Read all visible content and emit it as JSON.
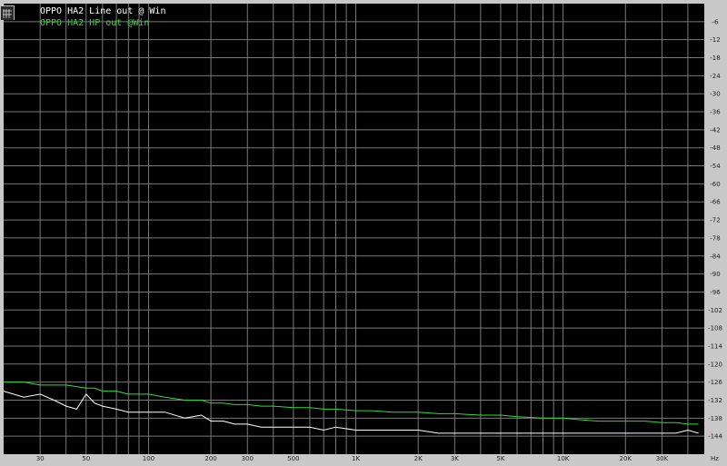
{
  "chart_data": {
    "type": "line",
    "title": "",
    "xlabel": "",
    "ylabel": "",
    "x_unit": "Hz",
    "x_scale": "log",
    "xlim": [
      20,
      48000
    ],
    "ylim": [
      -150,
      0
    ],
    "x_ticks": [
      30,
      50,
      100,
      200,
      300,
      500,
      1000,
      2000,
      3000,
      5000,
      10000,
      20000,
      30000
    ],
    "x_tick_labels": [
      "30",
      "50",
      "100",
      "200",
      "300",
      "500",
      "1K",
      "2K",
      "3K",
      "5K",
      "10K",
      "20K",
      "30K"
    ],
    "y_ticks": [
      -6,
      -12,
      -18,
      -24,
      -30,
      -36,
      -42,
      -48,
      -54,
      -60,
      -66,
      -72,
      -78,
      -84,
      -90,
      -96,
      -102,
      -108,
      -114,
      -120,
      -126,
      -132,
      -138,
      -144
    ],
    "y_tick_labels": [
      "-6",
      "-12",
      "-18",
      "-24",
      "-30",
      "-36",
      "-42",
      "-48",
      "-54",
      "-60",
      "-66",
      "-72",
      "-78",
      "-84",
      "-90",
      "-96",
      "-102",
      "-108",
      "-114",
      "-120",
      "-126",
      "-132",
      "-138",
      "-144"
    ],
    "grid": true,
    "legend_position": "top-left",
    "background_color": "#000000",
    "grid_color": "#7a7a7a",
    "series": [
      {
        "name": "OPPO HA2 Line out @ Win",
        "color": "#ffffff",
        "x": [
          20,
          25,
          30,
          35,
          40,
          45,
          50,
          55,
          60,
          70,
          80,
          100,
          120,
          150,
          180,
          200,
          230,
          260,
          300,
          350,
          400,
          500,
          600,
          700,
          800,
          1000,
          1200,
          1500,
          2000,
          2500,
          3000,
          4000,
          5000,
          6000,
          8000,
          10000,
          12000,
          15000,
          20000,
          25000,
          30000,
          35000,
          40000,
          45000
        ],
        "y": [
          -129,
          -131,
          -130,
          -132,
          -134,
          -135,
          -130,
          -133,
          -134,
          -135,
          -136,
          -136,
          -136,
          -138,
          -137,
          -139,
          -139,
          -140,
          -140,
          -141,
          -141,
          -141,
          -141,
          -142,
          -141,
          -142,
          -142,
          -142,
          -142,
          -143,
          -143,
          -143,
          -143,
          -143,
          -143,
          -143,
          -143,
          -143,
          -143,
          -143,
          -143,
          -143,
          -142,
          -143
        ]
      },
      {
        "name": "OPPO HA2 HP out @Win",
        "color": "#32dc32",
        "x": [
          20,
          25,
          30,
          35,
          40,
          45,
          50,
          55,
          60,
          70,
          80,
          100,
          120,
          150,
          180,
          200,
          230,
          260,
          300,
          350,
          400,
          500,
          600,
          700,
          800,
          1000,
          1200,
          1500,
          2000,
          2500,
          3000,
          4000,
          5000,
          6000,
          8000,
          10000,
          12000,
          15000,
          20000,
          25000,
          30000,
          35000,
          40000,
          45000
        ],
        "y": [
          -126,
          -126,
          -127,
          -127,
          -127,
          -127.5,
          -128,
          -128,
          -129,
          -129,
          -130,
          -130,
          -131,
          -132,
          -132,
          -133,
          -133,
          -133.5,
          -133.5,
          -134,
          -134,
          -134.5,
          -134.5,
          -135,
          -135,
          -135.5,
          -135.5,
          -136,
          -136,
          -136.5,
          -136.5,
          -137,
          -137,
          -137.5,
          -138,
          -138,
          -138.5,
          -139,
          -139,
          -139,
          -139.5,
          -139.5,
          -140,
          -140
        ]
      }
    ]
  }
}
